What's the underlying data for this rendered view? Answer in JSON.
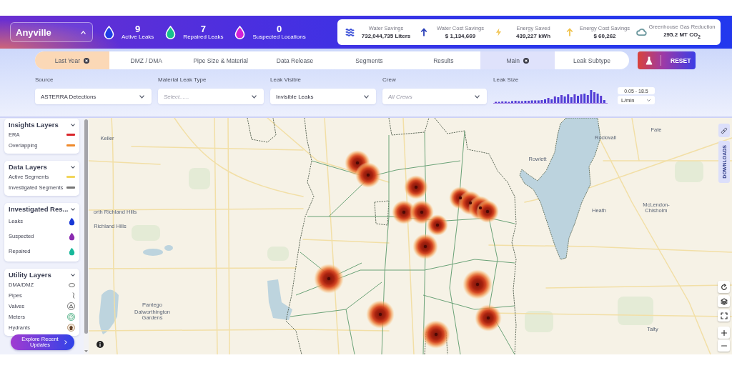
{
  "header": {
    "city_selector": {
      "value": "Anyville"
    },
    "stats": [
      {
        "count": "9",
        "label": "Active Leaks",
        "color": "#1f3fe6"
      },
      {
        "count": "7",
        "label": "Repaired Leaks",
        "color": "#18c08e"
      },
      {
        "count": "0",
        "label": "Suspected Locations",
        "color": "#d421d6"
      }
    ],
    "savings": [
      {
        "kind": "waves",
        "label": "Water Savings",
        "value": "732,044,735 Liters",
        "color": "#3a4fd8"
      },
      {
        "kind": "arrow",
        "label": "Water Cost Savings",
        "value": "$ 1,134,669",
        "color": "#2a3fb8"
      },
      {
        "kind": "bolt",
        "label": "Energy Saved",
        "value": "439,227 kWh",
        "color": "#f2c75a"
      },
      {
        "kind": "arrow",
        "label": "Energy Cost Savings",
        "value": "$ 60,262",
        "color": "#f0c24a"
      },
      {
        "kind": "cloud",
        "label": "Greenhouse Gas Reduction",
        "value": "295.2 MT CO$_{2}$",
        "color": "#6f9aa0"
      }
    ]
  },
  "filter_bar": {
    "tabs": [
      {
        "kind": "timeframe",
        "label": "Last Year",
        "selected": true
      },
      {
        "kind": "tab",
        "label": "DMZ / DMA",
        "selected": false
      },
      {
        "kind": "tab",
        "label": "Pipe Size & Material",
        "selected": false
      },
      {
        "kind": "tab",
        "label": "Data Release",
        "selected": false
      },
      {
        "kind": "tab",
        "label": "Segments",
        "selected": false
      },
      {
        "kind": "tab",
        "label": "Results",
        "selected": false
      },
      {
        "kind": "tab",
        "label": "Main",
        "selected": true
      },
      {
        "kind": "tab",
        "label": "Leak Subtype",
        "selected": false
      }
    ],
    "reset_button": {
      "label": "RESET"
    },
    "filters": [
      {
        "kind": "dropdown",
        "label": "Source",
        "value": "ASTERRA Detections"
      },
      {
        "kind": "dropdown",
        "label": "Material Leak Type",
        "placeholder": "Select......"
      },
      {
        "kind": "dropdown",
        "label": "Leak Visible",
        "value": "Invisible Leaks"
      },
      {
        "kind": "dropdown",
        "label": "Crew",
        "placeholder": "All Crews"
      },
      {
        "kind": "histogram",
        "label": "Leak Size",
        "range": "0.05 - 18.5",
        "unit": "L/min"
      }
    ]
  },
  "layers_panel": {
    "groups": [
      {
        "title": "Insights Layers",
        "expanded": true,
        "items": [
          {
            "kind": "line",
            "label": "ERA",
            "color": "#d9262b"
          },
          {
            "kind": "line",
            "label": "Overlapping",
            "color": "#ef8a2b"
          }
        ]
      },
      {
        "title": "Data Layers",
        "expanded": true,
        "items": [
          {
            "kind": "line",
            "label": "Active Segments",
            "color": "#f2d65a"
          },
          {
            "kind": "line",
            "label": "Investigated Segments",
            "color": "#777777"
          }
        ]
      },
      {
        "title": "Investigated Res...",
        "expanded": true,
        "items": [
          {
            "kind": "drop",
            "label": "Leaks",
            "color": "#1737d6"
          },
          {
            "kind": "drop",
            "label": "Suspected",
            "color": "#8a2bb0"
          },
          {
            "kind": "drop",
            "label": "Repaired",
            "color": "#17b89a"
          }
        ]
      },
      {
        "title": "Utility Layers",
        "expanded": true,
        "items": [
          {
            "kind": "zone",
            "label": "DMA/DMZ"
          },
          {
            "kind": "pipe",
            "label": "Pipes"
          },
          {
            "kind": "valve",
            "label": "Valves"
          },
          {
            "kind": "meter",
            "label": "Meters"
          },
          {
            "kind": "hydrant",
            "label": "Hydrants"
          }
        ]
      }
    ],
    "explore_button": {
      "label": "Explore Recent Updates"
    }
  },
  "map": {
    "place_labels": [
      "Keller",
      "orth Richland Hills",
      "Richland Hills",
      "Pantego",
      "Dalworthington Gardens",
      "Rowlett",
      "Rockwall",
      "Fate",
      "Heath",
      "McLendon-Chisholm",
      "Talty"
    ],
    "downloads_tab": {
      "label": "DOWNLOADS"
    }
  }
}
